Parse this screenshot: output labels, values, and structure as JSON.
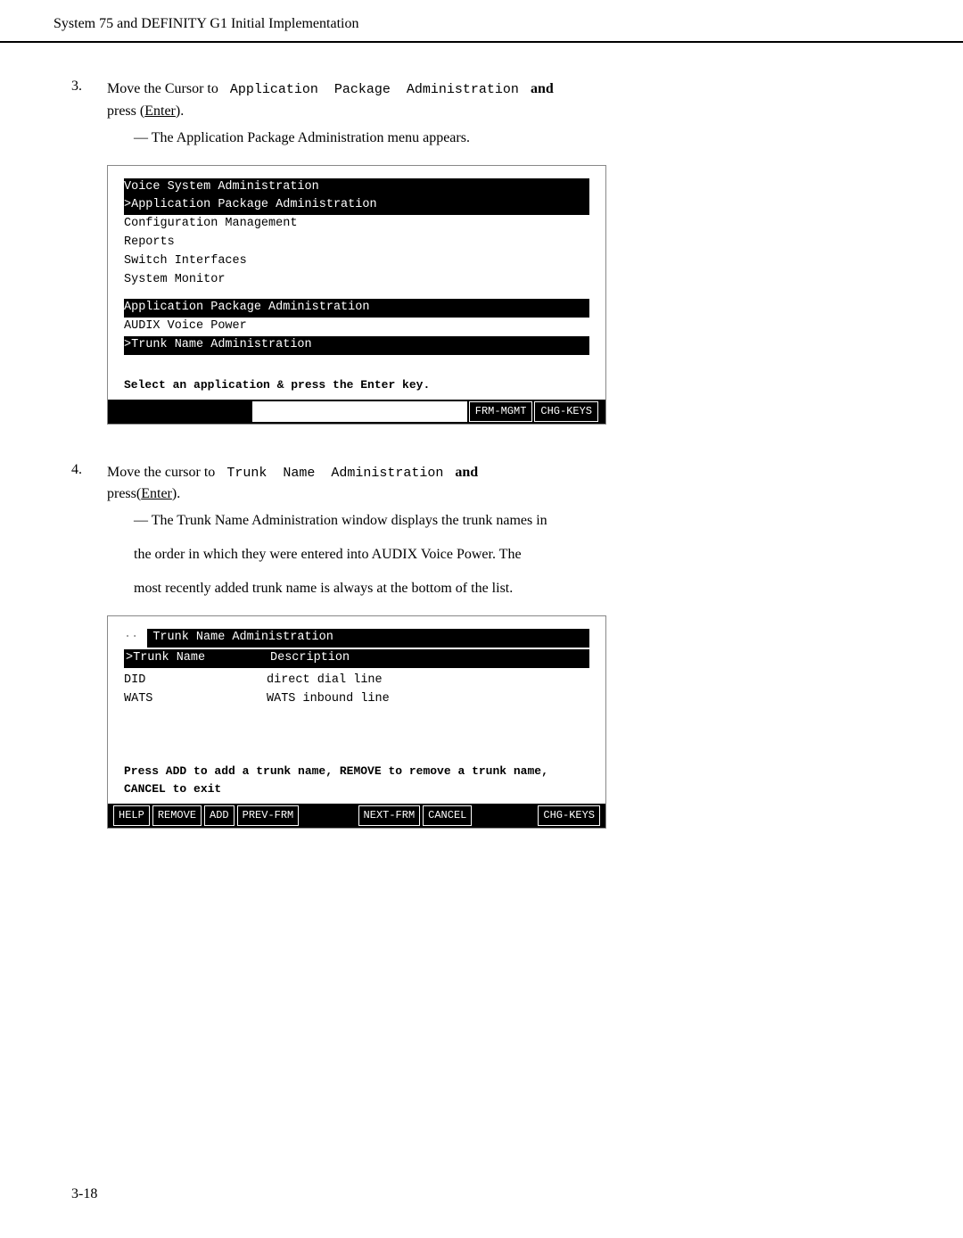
{
  "header": {
    "title": "System 75 and DEFINITY G1 Initial Implementation"
  },
  "step3": {
    "number": "3.",
    "text_prefix": "Move the Cursor to",
    "code": "Application   Package   Administration",
    "text_suffix_bold": "and",
    "text2": "press (",
    "enter_link": "Enter",
    "text2_close": ").",
    "subtext": "— The Application Package Administration menu appears."
  },
  "menu1": {
    "lines": [
      {
        "text": "Voice System Administration",
        "style": "highlighted"
      },
      {
        "text": ">Application Package Administration",
        "style": "selected"
      },
      {
        "text": "Configuration Management",
        "style": "normal"
      },
      {
        "text": "Reports",
        "style": "normal"
      },
      {
        "text": "Switch Interfaces",
        "style": "normal"
      },
      {
        "text": "System Monitor",
        "style": "normal"
      }
    ],
    "submenu": {
      "title": "Application Package Administration",
      "items": [
        {
          "text": "AUDIX Voice Power",
          "style": "normal"
        },
        {
          "text": ">Trunk Name Administration",
          "style": "selected"
        }
      ]
    },
    "status": "Select an application & press the Enter key.",
    "toolbar": [
      {
        "label": "FRM-MGMT",
        "active": true
      },
      {
        "label": "CHG-KEYS",
        "active": true
      }
    ]
  },
  "step4": {
    "number": "4.",
    "text_prefix": "Move the cursor to",
    "code": "Trunk   Name   Administration",
    "text_suffix_bold": "and",
    "text2": "press(",
    "enter_link": "Enter",
    "text2_close": ").",
    "subtext1": "— The Trunk Name Administration window displays the trunk names in",
    "subtext2": "the order in which they were entered into AUDIX Voice Power. The",
    "subtext3": "most recently added trunk name is always at the bottom of the list."
  },
  "menu2": {
    "title": "Trunk Name Administration",
    "col1": "Trunk Name",
    "col2": "Description",
    "rows": [
      {
        "name": "DID",
        "desc": "direct dial line"
      },
      {
        "name": "WATS",
        "desc": "WATS inbound line"
      }
    ],
    "status": "Press ADD to add a trunk name, REMOVE to remove a trunk name, CANCEL to exit",
    "toolbar": [
      {
        "label": "HELP",
        "active": true
      },
      {
        "label": "REMOVE",
        "active": true
      },
      {
        "label": "ADD",
        "active": true
      },
      {
        "label": "PREV-FRM",
        "active": true
      },
      {
        "label": "NEXT-FRM",
        "active": true
      },
      {
        "label": "CANCEL",
        "active": true
      },
      {
        "label": "CHG-KEYS",
        "active": true
      }
    ]
  },
  "page_number": "3-18"
}
